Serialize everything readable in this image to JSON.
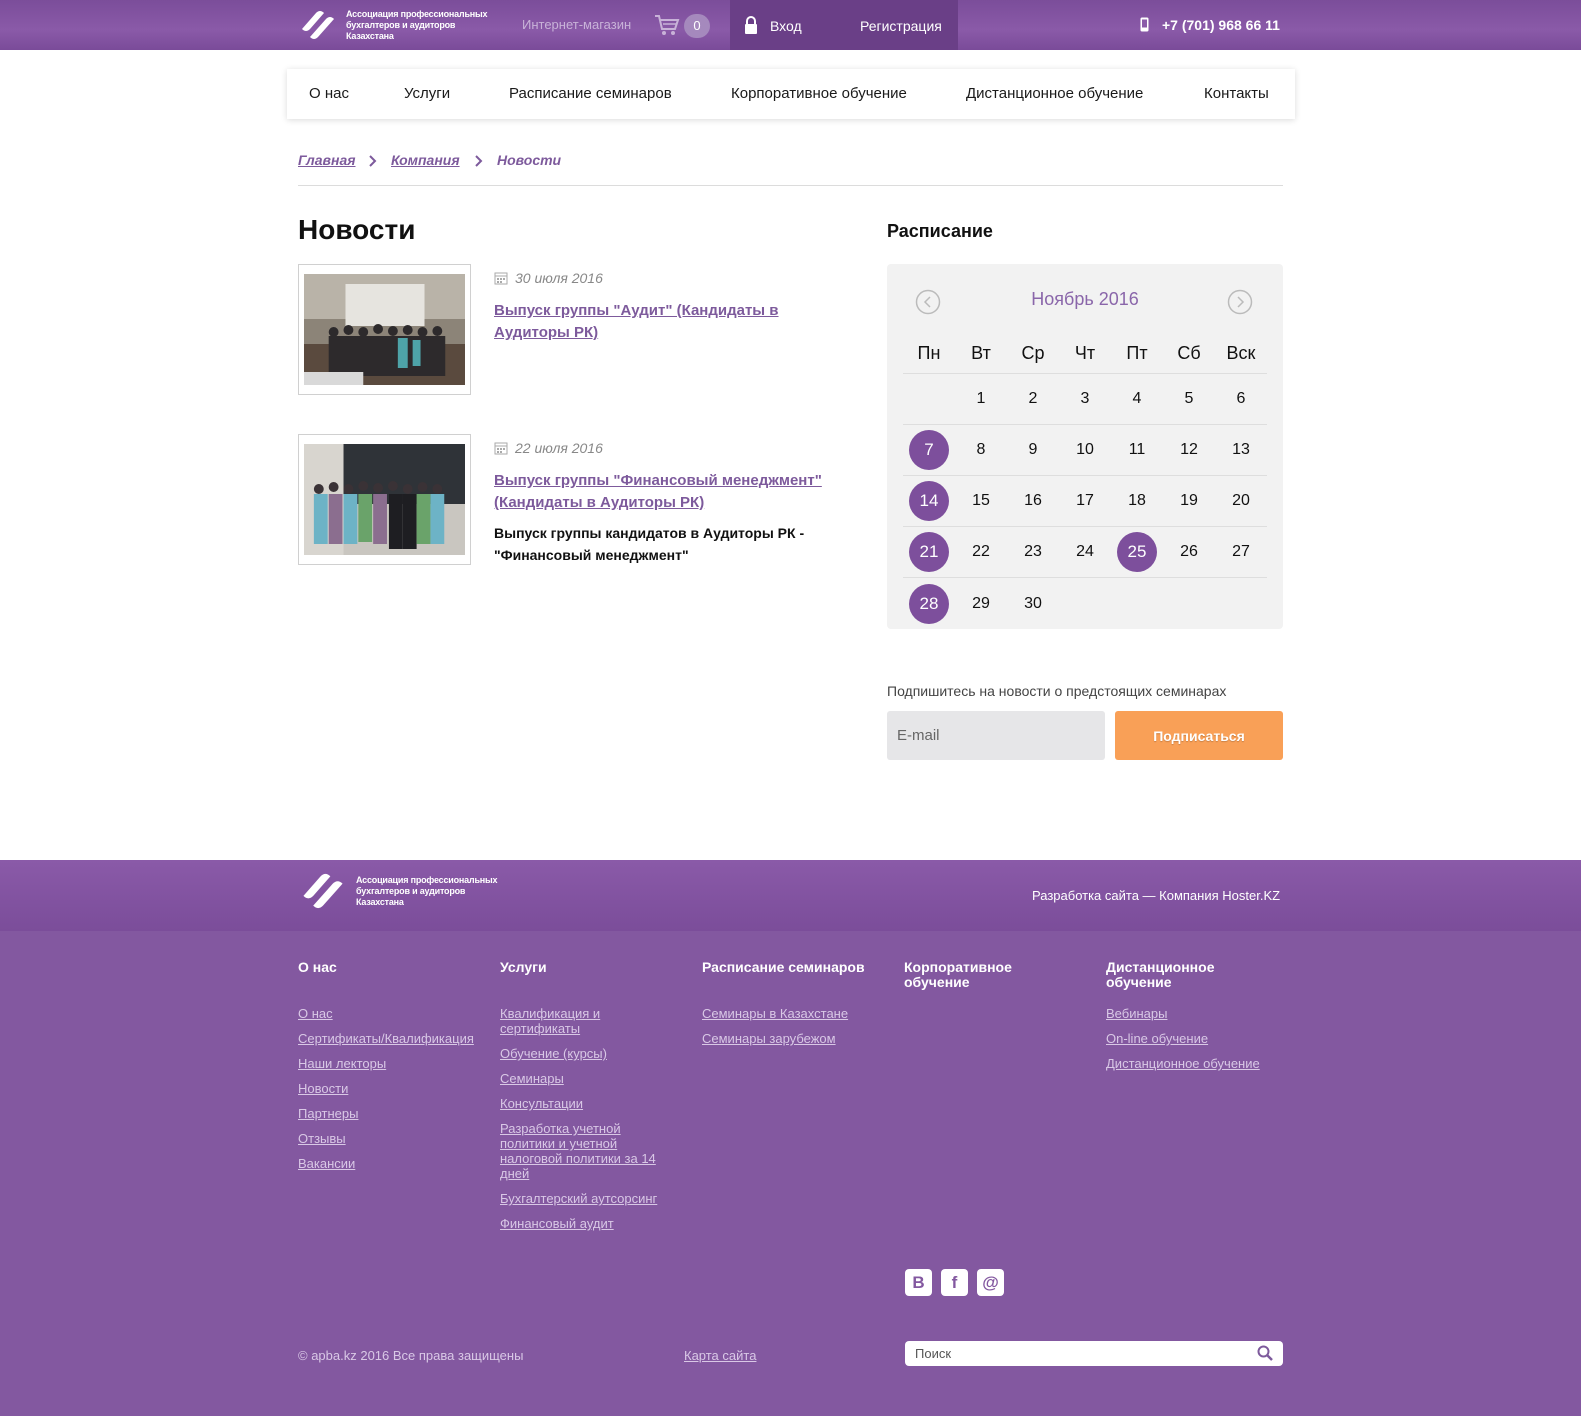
{
  "header": {
    "logo_lines": [
      "Ассоциация профессиональных",
      "бухгалтеров и аудиторов",
      "Казахстана"
    ],
    "shop_label": "Интернет-магазин",
    "cart_count": "0",
    "login_label": "Вход",
    "register_label": "Регистрация",
    "phone": "+7 (701) 968 66 11"
  },
  "nav": [
    "О нас",
    "Услуги",
    "Расписание семинаров",
    "Корпоративное обучение",
    "Дистанционное обучение",
    "Контакты"
  ],
  "breadcrumb": {
    "home": "Главная",
    "company": "Компания",
    "current": "Новости"
  },
  "page_title": "Новости",
  "news": [
    {
      "date": "30 июля 2016",
      "title": "Выпуск группы \"Аудит\" (Кандидаты в Аудиторы РК)",
      "description": ""
    },
    {
      "date": "22 июля 2016",
      "title": "Выпуск группы \"Финансовый менеджмент\" (Кандидаты в Аудиторы РК)",
      "description": "Выпуск группы кандидатов в Аудиторы РК - \"Финансовый менеджмент\""
    }
  ],
  "schedule": {
    "title": "Расписание",
    "month": "Ноябрь 2016",
    "weekdays": [
      "Пн",
      "Вт",
      "Ср",
      "Чт",
      "Пт",
      "Сб",
      "Вск"
    ],
    "weeks": [
      [
        "",
        "1",
        "2",
        "3",
        "4",
        "5",
        "6"
      ],
      [
        "7",
        "8",
        "9",
        "10",
        "11",
        "12",
        "13"
      ],
      [
        "14",
        "15",
        "16",
        "17",
        "18",
        "19",
        "20"
      ],
      [
        "21",
        "22",
        "23",
        "24",
        "25",
        "26",
        "27"
      ],
      [
        "28",
        "29",
        "30",
        "",
        "",
        "",
        ""
      ]
    ],
    "event_days": [
      "7",
      "14",
      "21",
      "25",
      "28"
    ]
  },
  "subscribe": {
    "label": "Подпишитесь на новости о предстоящих семинарах",
    "placeholder": "E-mail",
    "button": "Подписаться"
  },
  "footer": {
    "logo_lines": [
      "Ассоциация профессиональных",
      "бухгалтеров и аудиторов",
      "Казахстана"
    ],
    "dev_credit": "Разработка сайта — Компания Hoster.KZ",
    "columns": [
      {
        "title": "О нас",
        "links": [
          "О нас",
          "Сертификаты/Квалификация",
          "Наши лекторы",
          "Новости",
          "Партнеры",
          "Отзывы",
          "Вакансии"
        ]
      },
      {
        "title": "Услуги",
        "links": [
          "Квалификация и сертификаты",
          "Обучение (курсы)",
          "Семинары",
          "Консультации",
          "Разработка учетной политики и учетной налоговой политики за 14 дней",
          "Бухгалтерский аутсорсинг",
          "Финансовый аудит"
        ]
      },
      {
        "title": "Расписание семинаров",
        "links": [
          "Семинары в Казахстане",
          "Семинары зарубежом"
        ]
      },
      {
        "title": "Корпоративное обучение",
        "links": []
      },
      {
        "title": "Дистанционное обучение",
        "links": [
          "Вебинары",
          "On-line обучение",
          "Дистанционное обучение"
        ]
      }
    ],
    "social": [
      "B",
      "f",
      "@"
    ],
    "copyright": "© apba.kz 2016 Все права защищены",
    "sitemap": "Карта сайта",
    "search_placeholder": "Поиск"
  },
  "colors": {
    "brand_purple": "#8358a0",
    "accent_orange": "#f9a057",
    "link_purple": "#7d5a9c"
  }
}
